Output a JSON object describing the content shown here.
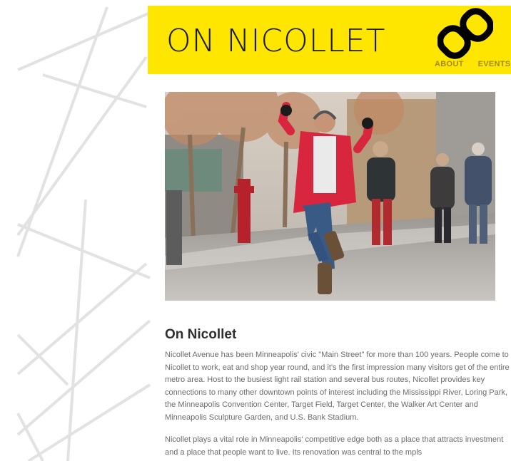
{
  "header": {
    "logo_text": "ON NICOLLET",
    "brand_color": "#ffe600",
    "icon": "link-icon",
    "nav": [
      "ABOUT",
      "EVENTS"
    ]
  },
  "hero": {
    "image_subject": "photo"
  },
  "article": {
    "title": "On Nicollet",
    "paragraphs": [
      "Nicollet Avenue has been Minneapolis' civic \"Main Street\" for more than 100 years. People come to Nicollet to work, eat and shop year round, and it's the first impression many visitors get of the entire metro area. Host to the busiest light rail station and several bus routes, Nicollet provides key connections to many other downtown points of interest including the Mississippi River, Loring Park, the Minneapolis Convention Center, Target Field, Target Center, the Walker Art Center and Minneapolis Sculpture Garden, and U.S. Bank Stadium.",
      "Nicollet plays a vital role in Minneapolis' competitive edge both as a place that attracts investment and a place that people want to live. Its renovation was central to the mpls"
    ]
  }
}
